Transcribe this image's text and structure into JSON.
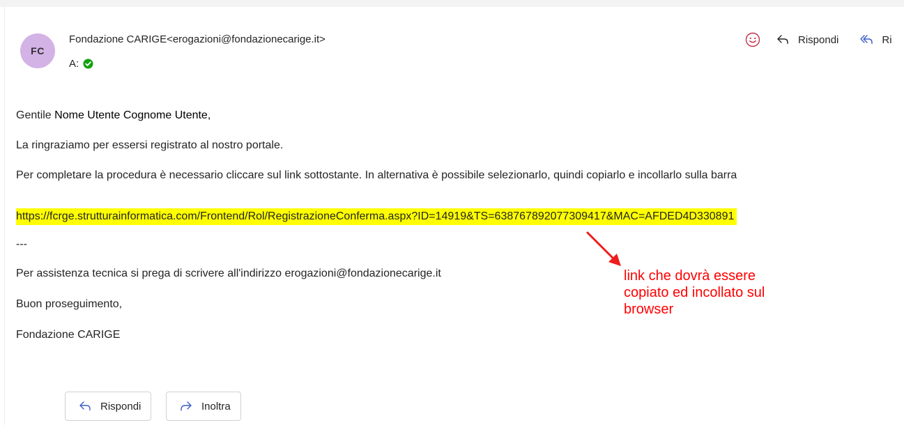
{
  "email": {
    "avatar_initials": "FC",
    "sender": "Fondazione CARIGE<erogazioni@fondazionecarige.it>",
    "to_label": "A:",
    "header_actions": {
      "reply_label": "Rispondi",
      "reply_all_label": "Ri"
    },
    "body": {
      "greeting_prefix": "Gentile",
      "greeting_name": "Nome Utente Cognome Utente,",
      "line1": "La ringraziamo per essersi registrato al nostro portale.",
      "line2": "Per completare la procedura è necessario cliccare sul link sottostante. In alternativa è possibile selezionarlo, quindi copiarlo e incollarlo sulla barra",
      "link": "https://fcrge.strutturainformatica.com/Frontend/Rol/RegistrazioneConferma.aspx?ID=14919&TS=638767892077309417&MAC=AFDED4D330891",
      "separator": "---",
      "support": "Per assistenza tecnica si prega di scrivere all'indirizzo erogazioni@fondazionecarige.it",
      "closing": "Buon proseguimento,",
      "signature": "Fondazione CARIGE"
    },
    "annotation": {
      "line1": "link che dovrà essere",
      "line2": "copiato ed incollato sul",
      "line3": "browser",
      "color": "#ff0000"
    },
    "footer": {
      "reply_label": "Rispondi",
      "forward_label": "Inoltra"
    },
    "colors": {
      "avatar_bg": "#d3b2e6",
      "highlight": "#ffff00",
      "check_green": "#13a10e",
      "icon_accent": "#c4314b",
      "link_icon": "#0f6cbd"
    }
  }
}
